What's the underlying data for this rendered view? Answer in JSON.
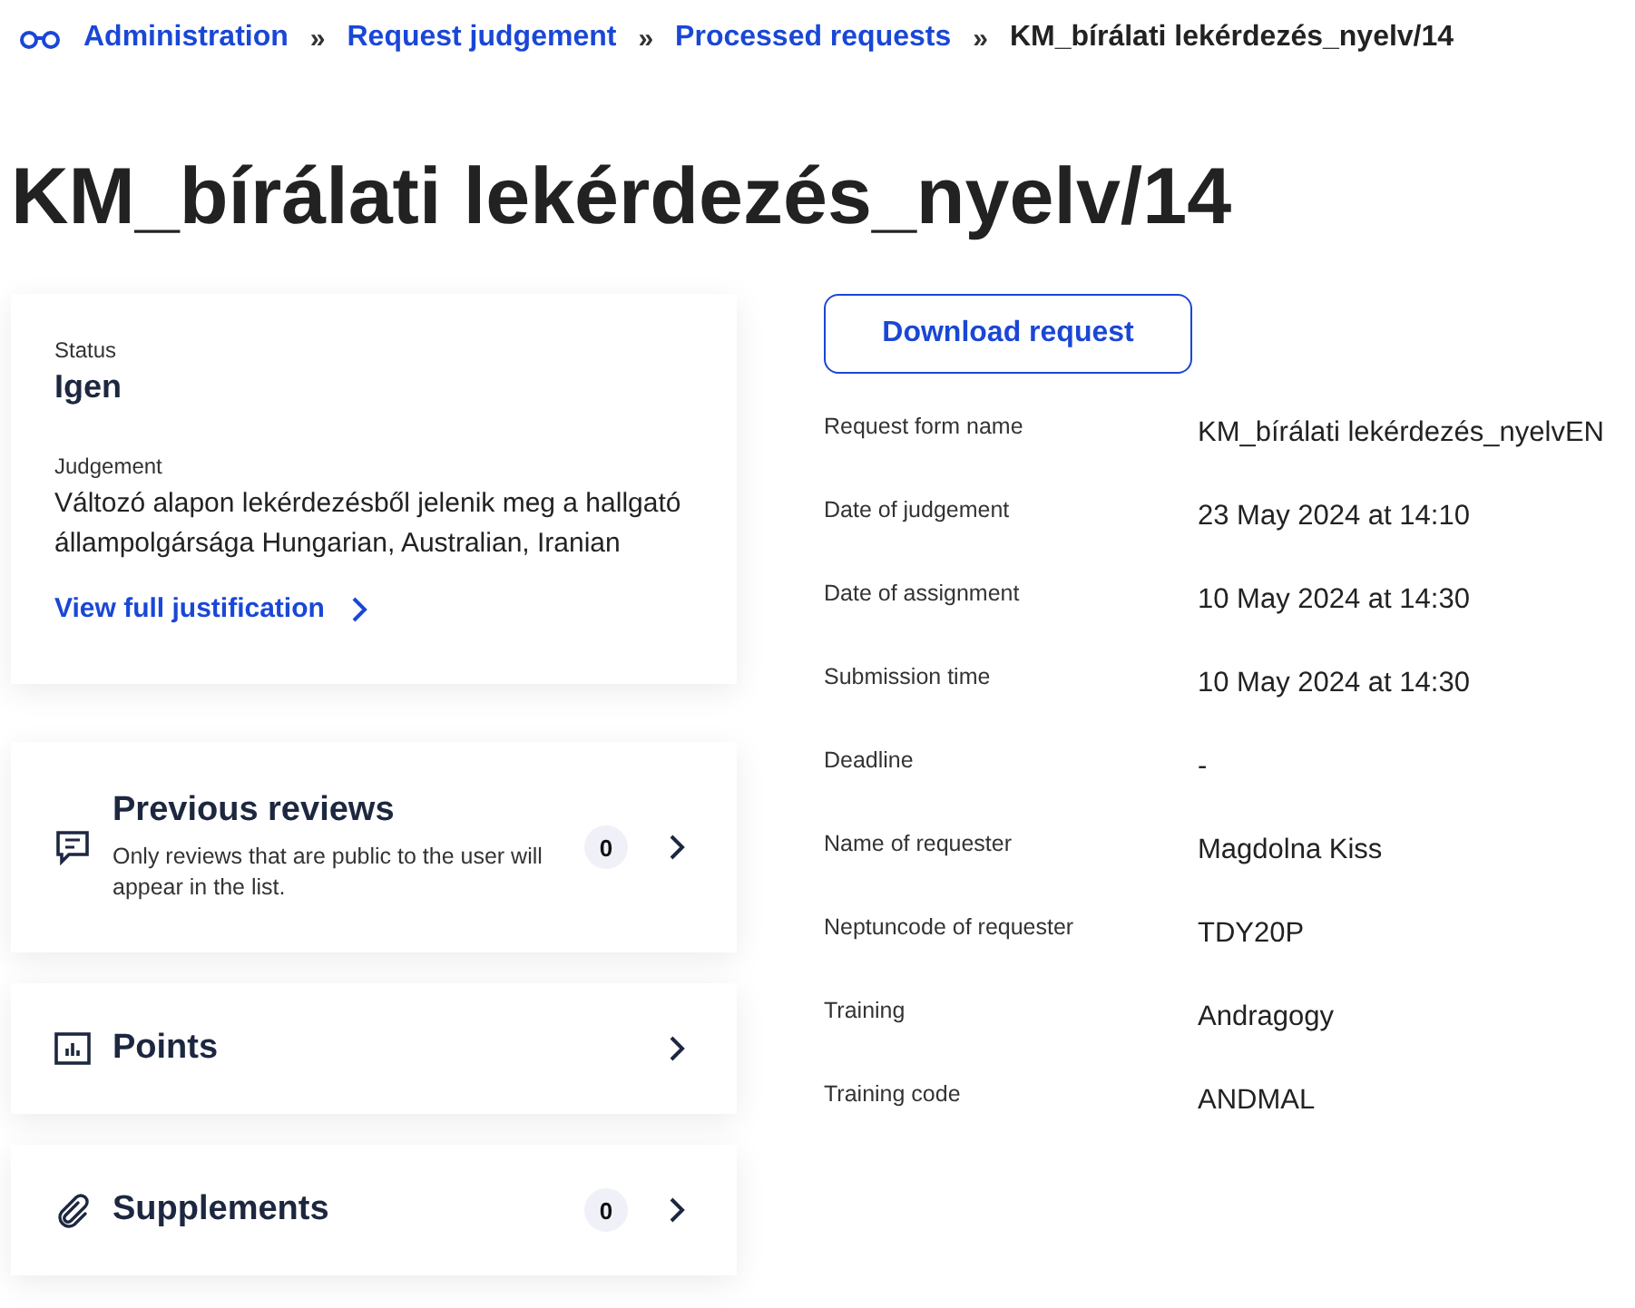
{
  "breadcrumb": [
    {
      "label": "Administration",
      "current": false
    },
    {
      "label": "Request judgement",
      "current": false
    },
    {
      "label": "Processed requests",
      "current": false
    },
    {
      "label": "KM_bírálati lekérdezés_nyelv/14",
      "current": true
    }
  ],
  "breadcrumb_separator": "»",
  "title": "KM_bírálati lekérdezés_nyelv/14",
  "summary": {
    "status_label": "Status",
    "status": "Igen",
    "judgement_label": "Judgement",
    "judgement": "Változó alapon lekérdezésből jelenik meg a hallgató állampolgársága Hungarian, Australian, Iranian",
    "link": "View full justification"
  },
  "panels": [
    {
      "kind": "reviews",
      "title": "Previous reviews",
      "note": "Only reviews that are public to the user will appear in the list.",
      "count": "0"
    },
    {
      "kind": "points",
      "title": "Points"
    },
    {
      "kind": "supplements",
      "title": "Supplements",
      "count": "0"
    }
  ],
  "download_button": "Download request",
  "details": [
    {
      "label": "Request form name",
      "value": "KM_bírálati lekérdezés_nyelvEN"
    },
    {
      "label": "Date of judgement",
      "value": "23 May 2024 at 14:10"
    },
    {
      "label": "Date of assignment",
      "value": "10 May 2024 at 14:30"
    },
    {
      "label": "Submission time",
      "value": "10 May 2024 at 14:30"
    },
    {
      "label": "Deadline",
      "value": "-"
    },
    {
      "label": "Name of requester",
      "value": "Magdolna Kiss"
    },
    {
      "label": "Neptuncode of requester",
      "value": "TDY20P"
    },
    {
      "label": "Training",
      "value": "Andragogy"
    },
    {
      "label": "Training code",
      "value": "ANDMAL"
    }
  ]
}
